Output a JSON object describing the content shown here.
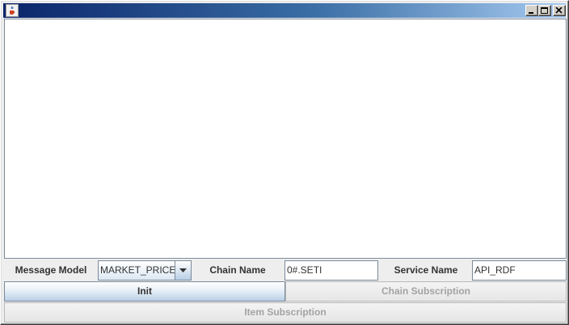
{
  "window": {
    "title": "",
    "titlebar_icon": "java-cup-icon",
    "controls": [
      "minimize-icon",
      "maximize-icon",
      "close-icon"
    ],
    "accent_colors": {
      "titlebar_start": "#0a246a",
      "titlebar_end": "#a6caf0",
      "button_gradient_end": "#b8cfe5"
    }
  },
  "form": {
    "message_model": {
      "label": "Message Model",
      "selected": "MARKET_PRICE"
    },
    "chain_name": {
      "label": "Chain Name",
      "value": "0#.SETI"
    },
    "service_name": {
      "label": "Service Name",
      "value": "API_RDF"
    }
  },
  "buttons": {
    "init": "Init",
    "chain_subscription": "Chain Subscription",
    "item_subscription": "Item Subscription"
  }
}
